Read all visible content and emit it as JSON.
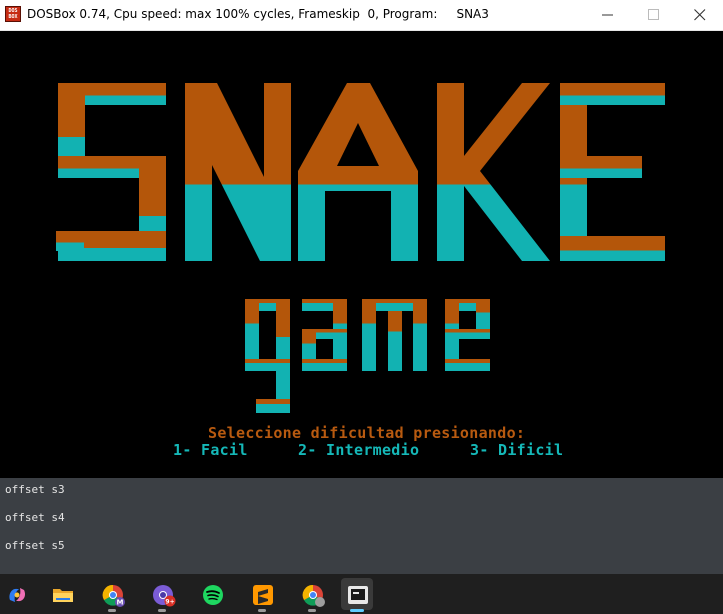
{
  "window": {
    "title": "DOSBox 0.74, Cpu speed: max 100% cycles, Frameskip  0, Program:     SNA3",
    "icon_text": "DOS BOX"
  },
  "game": {
    "logo_title": "SNAKE",
    "logo_subtitle": "game",
    "prompt": "Seleccione dificultad presionando:",
    "options": [
      "1- Facil",
      "2- Intermedio",
      "3- Dificil"
    ],
    "colors": {
      "orange": "#b4560a",
      "cyan": "#12b2b2",
      "background": "#000000"
    }
  },
  "editor": {
    "lines": [
      "offset s3",
      "offset s4",
      "offset s5"
    ]
  },
  "taskbar": {
    "items": [
      "copilot-icon",
      "file-explorer-icon",
      "chrome-icon",
      "chrome-profile-icon",
      "spotify-icon",
      "sublime-text-icon",
      "chrome-icon",
      "dosbox-icon"
    ]
  }
}
